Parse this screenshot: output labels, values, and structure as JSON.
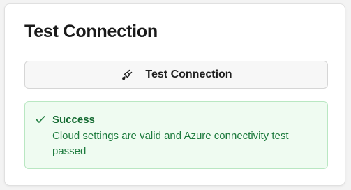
{
  "card": {
    "title": "Test Connection"
  },
  "test_button": {
    "label": "Test Connection",
    "icon": "plug-icon"
  },
  "alert": {
    "status": "success",
    "icon": "checkmark-icon",
    "title": "Success",
    "message": "Cloud settings are valid and Azure connectivity test passed"
  },
  "colors": {
    "success_text": "#176c34",
    "success_bg": "#effbf1",
    "success_border": "#b9e7c2"
  }
}
